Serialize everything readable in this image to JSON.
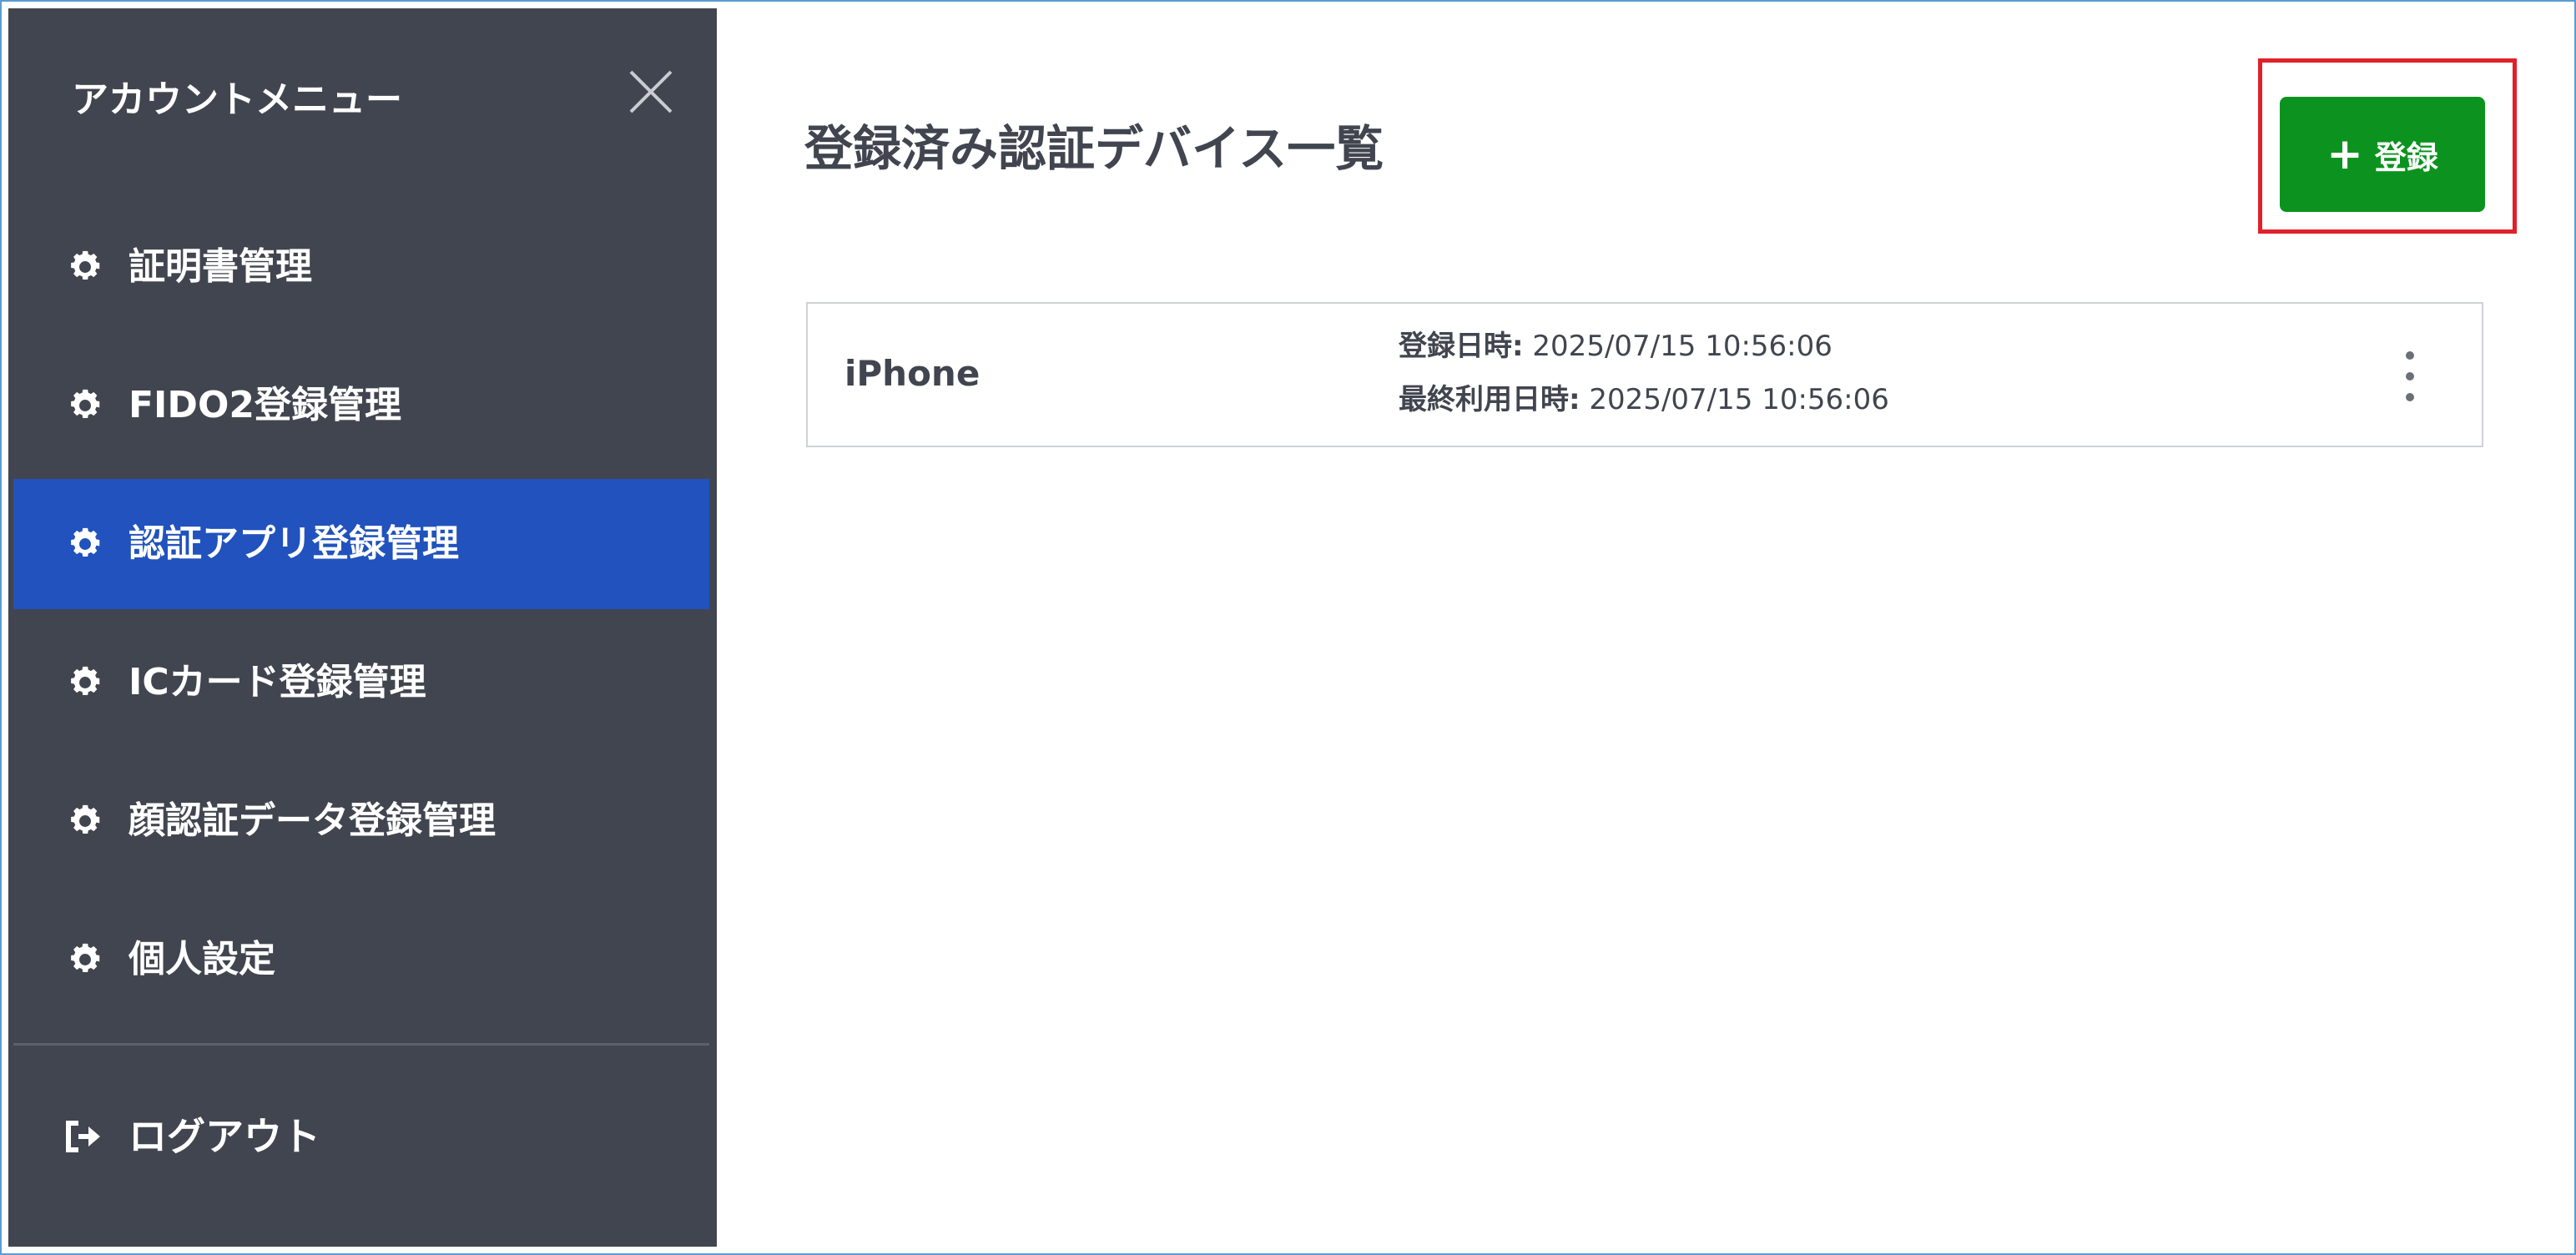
{
  "sidebar": {
    "title": "アカウントメニュー",
    "items": [
      {
        "label": "証明書管理",
        "icon": "gear-icon"
      },
      {
        "label": "FIDO2登録管理",
        "icon": "gear-icon"
      },
      {
        "label": "認証アプリ登録管理",
        "icon": "gear-icon",
        "active": true
      },
      {
        "label": "ICカード登録管理",
        "icon": "gear-icon"
      },
      {
        "label": "顔認証データ登録管理",
        "icon": "gear-icon"
      },
      {
        "label": "個人設定",
        "icon": "gear-icon"
      }
    ],
    "logout_label": "ログアウト"
  },
  "main": {
    "title": "登録済み認証デバイス一覧",
    "register_label": "登録",
    "devices": [
      {
        "name": "iPhone",
        "registered_label": "登録日時:",
        "registered_value": "2025/07/15 10:56:06",
        "last_used_label": "最終利用日時:",
        "last_used_value": "2025/07/15 10:56:06"
      }
    ]
  },
  "colors": {
    "sidebar_bg": "#41454f",
    "active_bg": "#2152bd",
    "primary_button": "#0c931f",
    "highlight": "#e0202a"
  }
}
